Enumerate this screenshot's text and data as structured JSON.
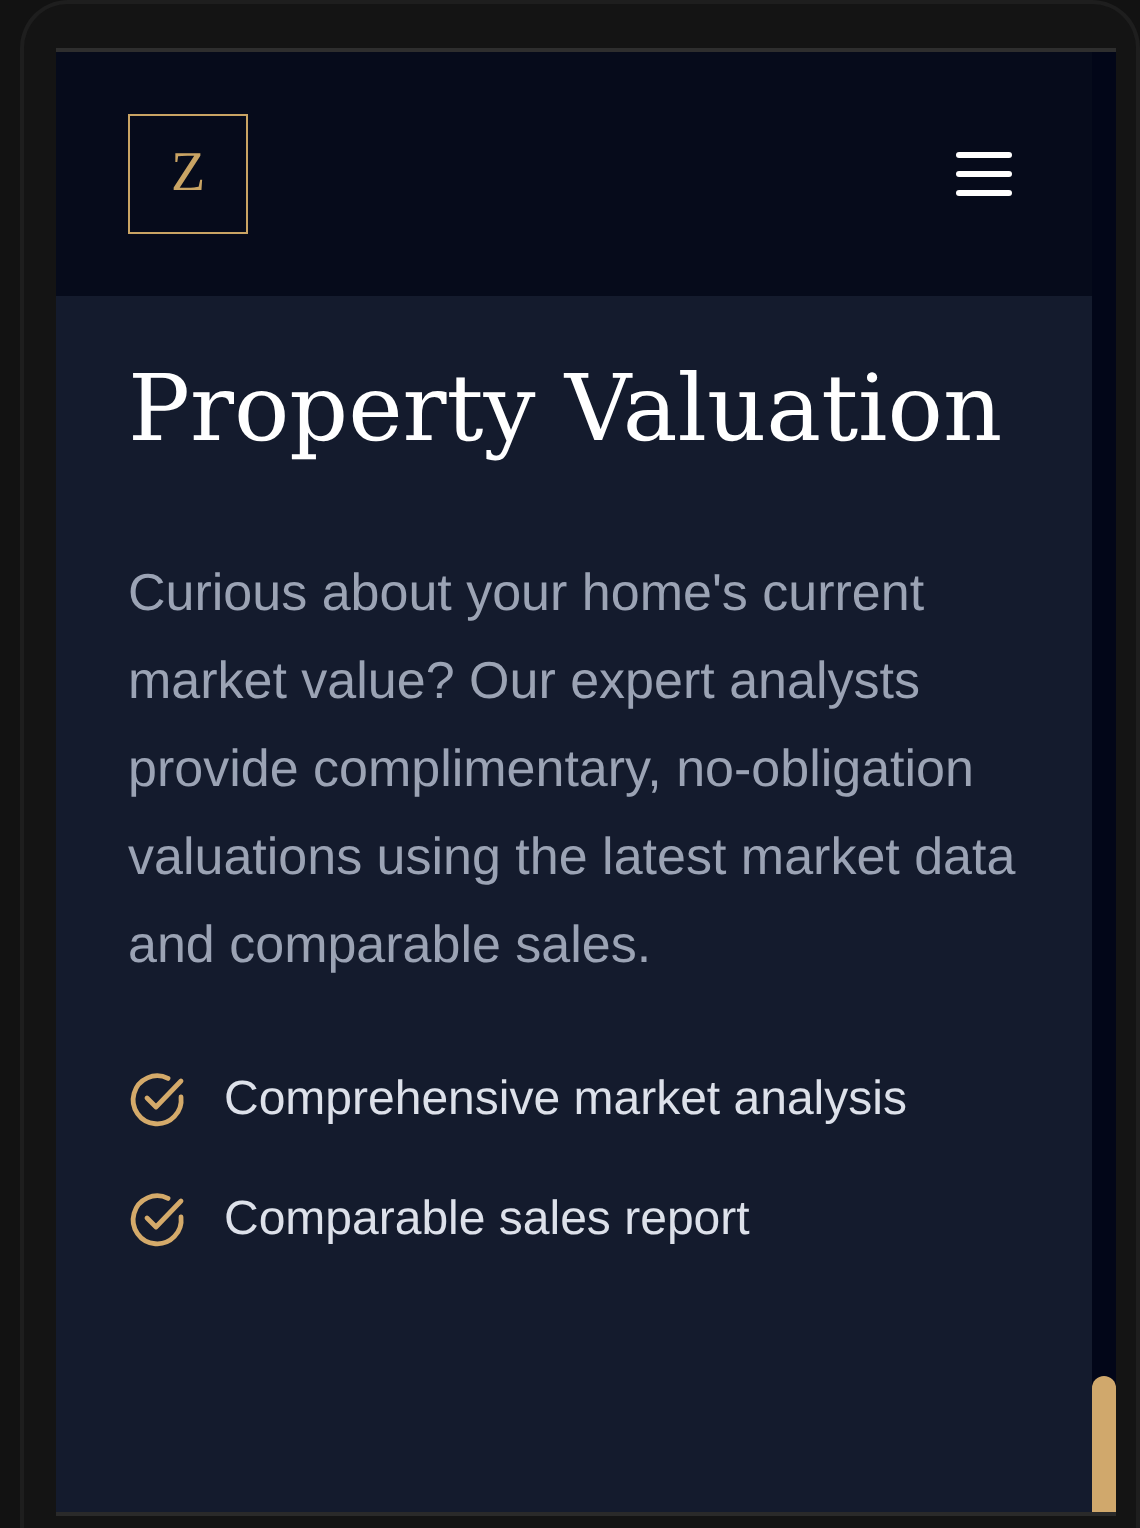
{
  "header": {
    "logo": "Z"
  },
  "section": {
    "title": "Property Valuation",
    "description": "Curious about your home's current market value? Our expert analysts provide complimentary, no-obligation valuations using the latest market data and comparable sales.",
    "features": [
      {
        "label": "Comprehensive market analysis"
      },
      {
        "label": "Comparable sales report"
      }
    ]
  }
}
